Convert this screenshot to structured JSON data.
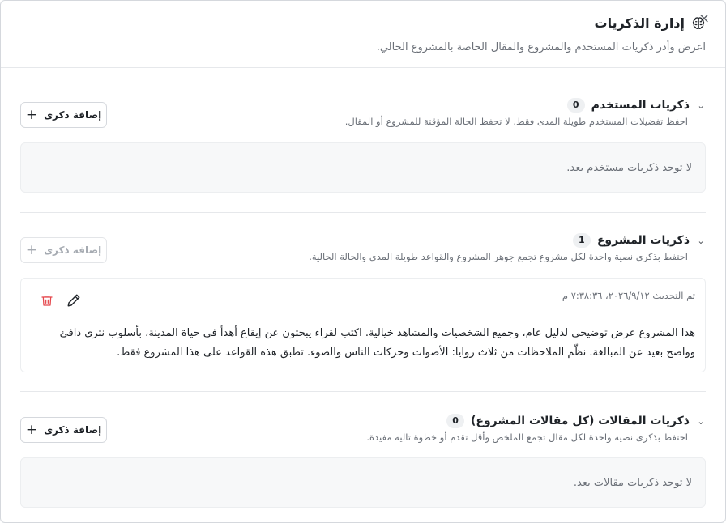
{
  "dialog": {
    "title": "إدارة الذكريات",
    "subtitle": "اعرض وأدر ذكريات المستخدم والمشروع والمقال الخاصة بالمشروع الحالي.",
    "close_icon": "×"
  },
  "sections": {
    "user": {
      "title": "ذكريات المستخدم",
      "count": "0",
      "description": "احفظ تفضيلات المستخدم طويلة المدى فقط. لا تحفظ الحالة المؤقتة للمشروع أو المقال.",
      "add_label": "إضافة ذكرى",
      "empty_text": "لا توجد ذكريات مستخدم بعد."
    },
    "project": {
      "title": "ذكريات المشروع",
      "count": "1",
      "description": "احتفظ بذكرى نصية واحدة لكل مشروع تجمع جوهر المشروع والقواعد طويلة المدى والحالة الحالية.",
      "add_label": "إضافة ذكرى",
      "memory": {
        "updated": "تم التحديث ٢٠٢٦/٩/١٢، ٧:٣٨:٣٦ م",
        "text": "هذا المشروع عرض توضيحي لدليل عام، وجميع الشخصيات والمشاهد خيالية. اكتب لقراء يبحثون عن إيقاع أهدأ في حياة المدينة، بأسلوب نثري دافئ وواضح بعيد عن المبالغة. نظّم الملاحظات من ثلاث زوايا: الأصوات وحركات الناس والضوء. تطبق هذه القواعد على هذا المشروع فقط."
      }
    },
    "article": {
      "title": "ذكريات المقالات (كل مقالات المشروع)",
      "count": "0",
      "description": "احتفظ بذكرى نصية واحدة لكل مقال تجمع الملخص وأقل تقدم أو خطوة تالية مفيدة.",
      "add_label": "إضافة ذكرى",
      "empty_text": "لا توجد ذكريات مقالات بعد."
    }
  },
  "colors": {
    "delete": "#e5484d",
    "border": "#d5d8dd",
    "muted": "#6b7078"
  }
}
